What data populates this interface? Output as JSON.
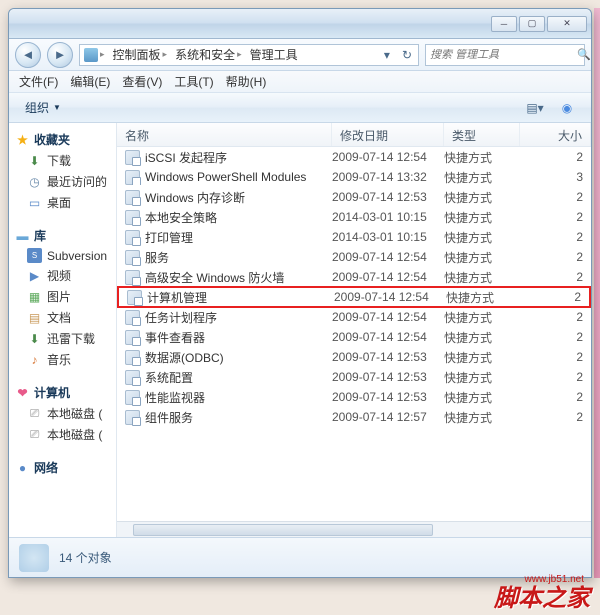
{
  "breadcrumb": [
    "控制面板",
    "系统和安全",
    "管理工具"
  ],
  "search_placeholder": "搜索 管理工具",
  "menubar": [
    {
      "label": "文件(F)"
    },
    {
      "label": "编辑(E)"
    },
    {
      "label": "查看(V)"
    },
    {
      "label": "工具(T)"
    },
    {
      "label": "帮助(H)"
    }
  ],
  "toolbar": {
    "organize": "组织",
    "organize_arrow": "▼"
  },
  "columns": {
    "name": "名称",
    "date": "修改日期",
    "type": "类型",
    "size": "大小"
  },
  "sidebar": {
    "favorites": {
      "head": "收藏夹",
      "items": [
        {
          "label": "下载",
          "ico": "ico-dl",
          "g": "⬇"
        },
        {
          "label": "最近访问的",
          "ico": "ico-clock",
          "g": "◷"
        },
        {
          "label": "桌面",
          "ico": "ico-desk",
          "g": "▭"
        }
      ]
    },
    "libraries": {
      "head": "库",
      "items": [
        {
          "label": "Subversion",
          "ico": "ico-sv",
          "g": "S"
        },
        {
          "label": "视频",
          "ico": "ico-vid",
          "g": "▶"
        },
        {
          "label": "图片",
          "ico": "ico-pic",
          "g": "▦"
        },
        {
          "label": "文档",
          "ico": "ico-doc",
          "g": "▤"
        },
        {
          "label": "迅雷下载",
          "ico": "ico-dl2",
          "g": "⬇"
        },
        {
          "label": "音乐",
          "ico": "ico-mus",
          "g": "♪"
        }
      ]
    },
    "computer": {
      "head": "计算机",
      "items": [
        {
          "label": "本地磁盘 (",
          "ico": "ico-hd",
          "g": "⎚"
        },
        {
          "label": "本地磁盘 (",
          "ico": "ico-hd",
          "g": "⎚"
        }
      ]
    },
    "network": {
      "head": "网络",
      "items": []
    }
  },
  "rows": [
    {
      "name": "iSCSI 发起程序",
      "date": "2009-07-14 12:54",
      "type": "快捷方式",
      "size": "2"
    },
    {
      "name": "Windows PowerShell Modules",
      "date": "2009-07-14 13:32",
      "type": "快捷方式",
      "size": "3"
    },
    {
      "name": "Windows 内存诊断",
      "date": "2009-07-14 12:53",
      "type": "快捷方式",
      "size": "2"
    },
    {
      "name": "本地安全策略",
      "date": "2014-03-01 10:15",
      "type": "快捷方式",
      "size": "2"
    },
    {
      "name": "打印管理",
      "date": "2014-03-01 10:15",
      "type": "快捷方式",
      "size": "2"
    },
    {
      "name": "服务",
      "date": "2009-07-14 12:54",
      "type": "快捷方式",
      "size": "2"
    },
    {
      "name": "高级安全 Windows 防火墙",
      "date": "2009-07-14 12:54",
      "type": "快捷方式",
      "size": "2"
    },
    {
      "name": "计算机管理",
      "date": "2009-07-14 12:54",
      "type": "快捷方式",
      "size": "2",
      "highlight": true
    },
    {
      "name": "任务计划程序",
      "date": "2009-07-14 12:54",
      "type": "快捷方式",
      "size": "2"
    },
    {
      "name": "事件查看器",
      "date": "2009-07-14 12:54",
      "type": "快捷方式",
      "size": "2"
    },
    {
      "name": "数据源(ODBC)",
      "date": "2009-07-14 12:53",
      "type": "快捷方式",
      "size": "2"
    },
    {
      "name": "系统配置",
      "date": "2009-07-14 12:53",
      "type": "快捷方式",
      "size": "2"
    },
    {
      "name": "性能监视器",
      "date": "2009-07-14 12:53",
      "type": "快捷方式",
      "size": "2"
    },
    {
      "name": "组件服务",
      "date": "2009-07-14 12:57",
      "type": "快捷方式",
      "size": "2"
    }
  ],
  "status": {
    "count": "14 个对象"
  },
  "watermark": {
    "text": "脚本之家",
    "url": "www.jb51.net"
  }
}
